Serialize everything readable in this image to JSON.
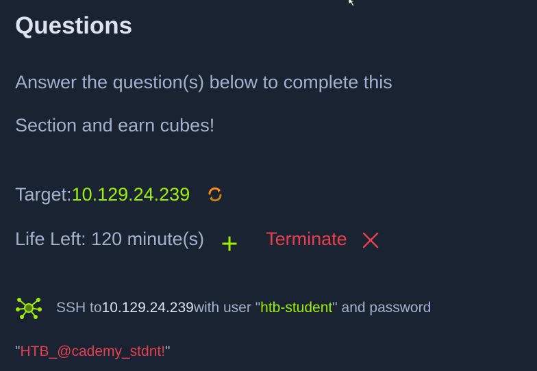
{
  "section": {
    "heading": "Questions",
    "intro_line1": "Answer the question(s) below to complete this",
    "intro_line2": "Section and earn cubes!"
  },
  "target": {
    "label": "Target: ",
    "ip": "10.129.24.239",
    "reset_icon": "refresh-icon"
  },
  "life": {
    "label": "Life Left: 120 minute(s)",
    "extend_icon": "plus-icon",
    "terminate_label": "Terminate",
    "terminate_icon": "close-icon"
  },
  "ssh": {
    "icon": "network-nodes-icon",
    "prefix": "SSH to ",
    "host": "10.129.24.239",
    "middle": " with user \"",
    "user": "htb-student",
    "suffix": "\" and password",
    "quote_open": "\"",
    "password": "HTB_@cademy_stdnt!",
    "quote_close": "\""
  },
  "colors": {
    "background": "#1a2332",
    "text": "#a4b1cd",
    "heading": "#dbe3f0",
    "accent_green": "#9fef00",
    "danger_red": "#e6404e",
    "orange": "#ff8c1a"
  }
}
